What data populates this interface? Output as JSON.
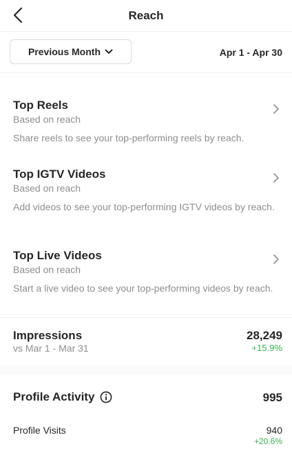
{
  "header": {
    "title": "Reach",
    "back_icon": "chevron-left-icon"
  },
  "filter": {
    "period_label": "Previous Month",
    "dropdown_icon": "chevron-down-icon",
    "date_range": "Apr 1 - Apr 30"
  },
  "sections": [
    {
      "title": "Top Reels",
      "subtitle": "Based on reach",
      "description": "Share reels to see your top-performing reels by reach."
    },
    {
      "title": "Top IGTV Videos",
      "subtitle": "Based on reach",
      "description": "Add videos to see your top-performing IGTV videos by reach."
    },
    {
      "title": "Top Live Videos",
      "subtitle": "Based on reach",
      "description": "Start a live video to see your top-performing videos by reach."
    }
  ],
  "impressions": {
    "title": "Impressions",
    "comparison": "vs Mar 1 - Mar 31",
    "value": "28,249",
    "change": "+15.9%"
  },
  "profile_activity": {
    "title": "Profile Activity",
    "value": "995",
    "info_icon": "info-icon",
    "rows": [
      {
        "label": "Profile Visits",
        "value": "940",
        "change": "+20.6%"
      }
    ]
  },
  "colors": {
    "positive": "#37b24d",
    "muted": "#8e8e8e",
    "text": "#262626"
  }
}
